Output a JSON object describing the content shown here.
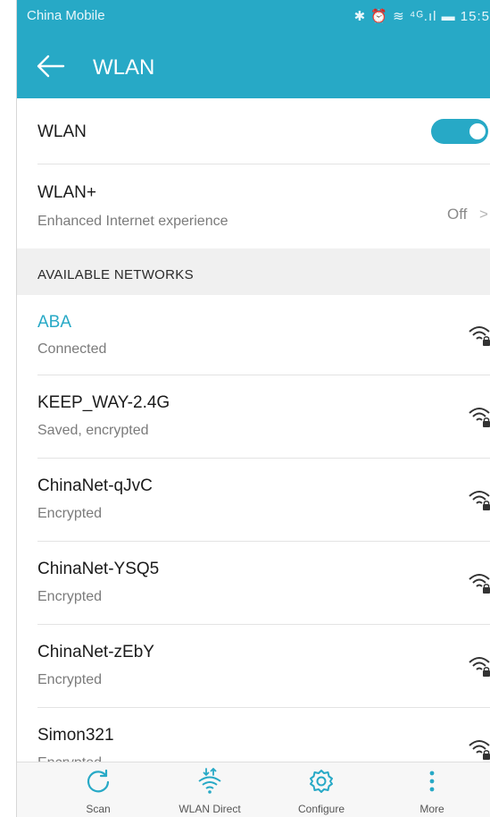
{
  "status_bar": {
    "carrier": "China Mobile",
    "right_text": "✱ ⏰ ≋ ⁴ᴳ.ıl ▬ 15:5"
  },
  "app_bar": {
    "title": "WLAN"
  },
  "wlan_toggle": {
    "label": "WLAN",
    "enabled": true
  },
  "wlan_plus": {
    "title": "WLAN+",
    "subtitle": "Enhanced Internet experience",
    "value": "Off",
    "chevron": ">"
  },
  "section_header": "AVAILABLE NETWORKS",
  "networks": [
    {
      "name": "ABA",
      "status": "Connected"
    },
    {
      "name": "KEEP_WAY-2.4G",
      "status": "Saved, encrypted"
    },
    {
      "name": "ChinaNet-qJvC",
      "status": "Encrypted"
    },
    {
      "name": "ChinaNet-YSQ5",
      "status": "Encrypted"
    },
    {
      "name": "ChinaNet-zEbY",
      "status": "Encrypted"
    },
    {
      "name": "Simon321",
      "status": "Encrypted"
    }
  ],
  "bottom_nav": [
    {
      "label": "Scan",
      "icon": "refresh-icon"
    },
    {
      "label": "WLAN Direct",
      "icon": "wlan-direct-icon"
    },
    {
      "label": "Configure",
      "icon": "gear-icon"
    },
    {
      "label": "More",
      "icon": "more-vertical-icon"
    }
  ],
  "colors": {
    "accent": "#27a9c6",
    "connected_text": "#27a9c6",
    "background": "#f2f2f2"
  }
}
